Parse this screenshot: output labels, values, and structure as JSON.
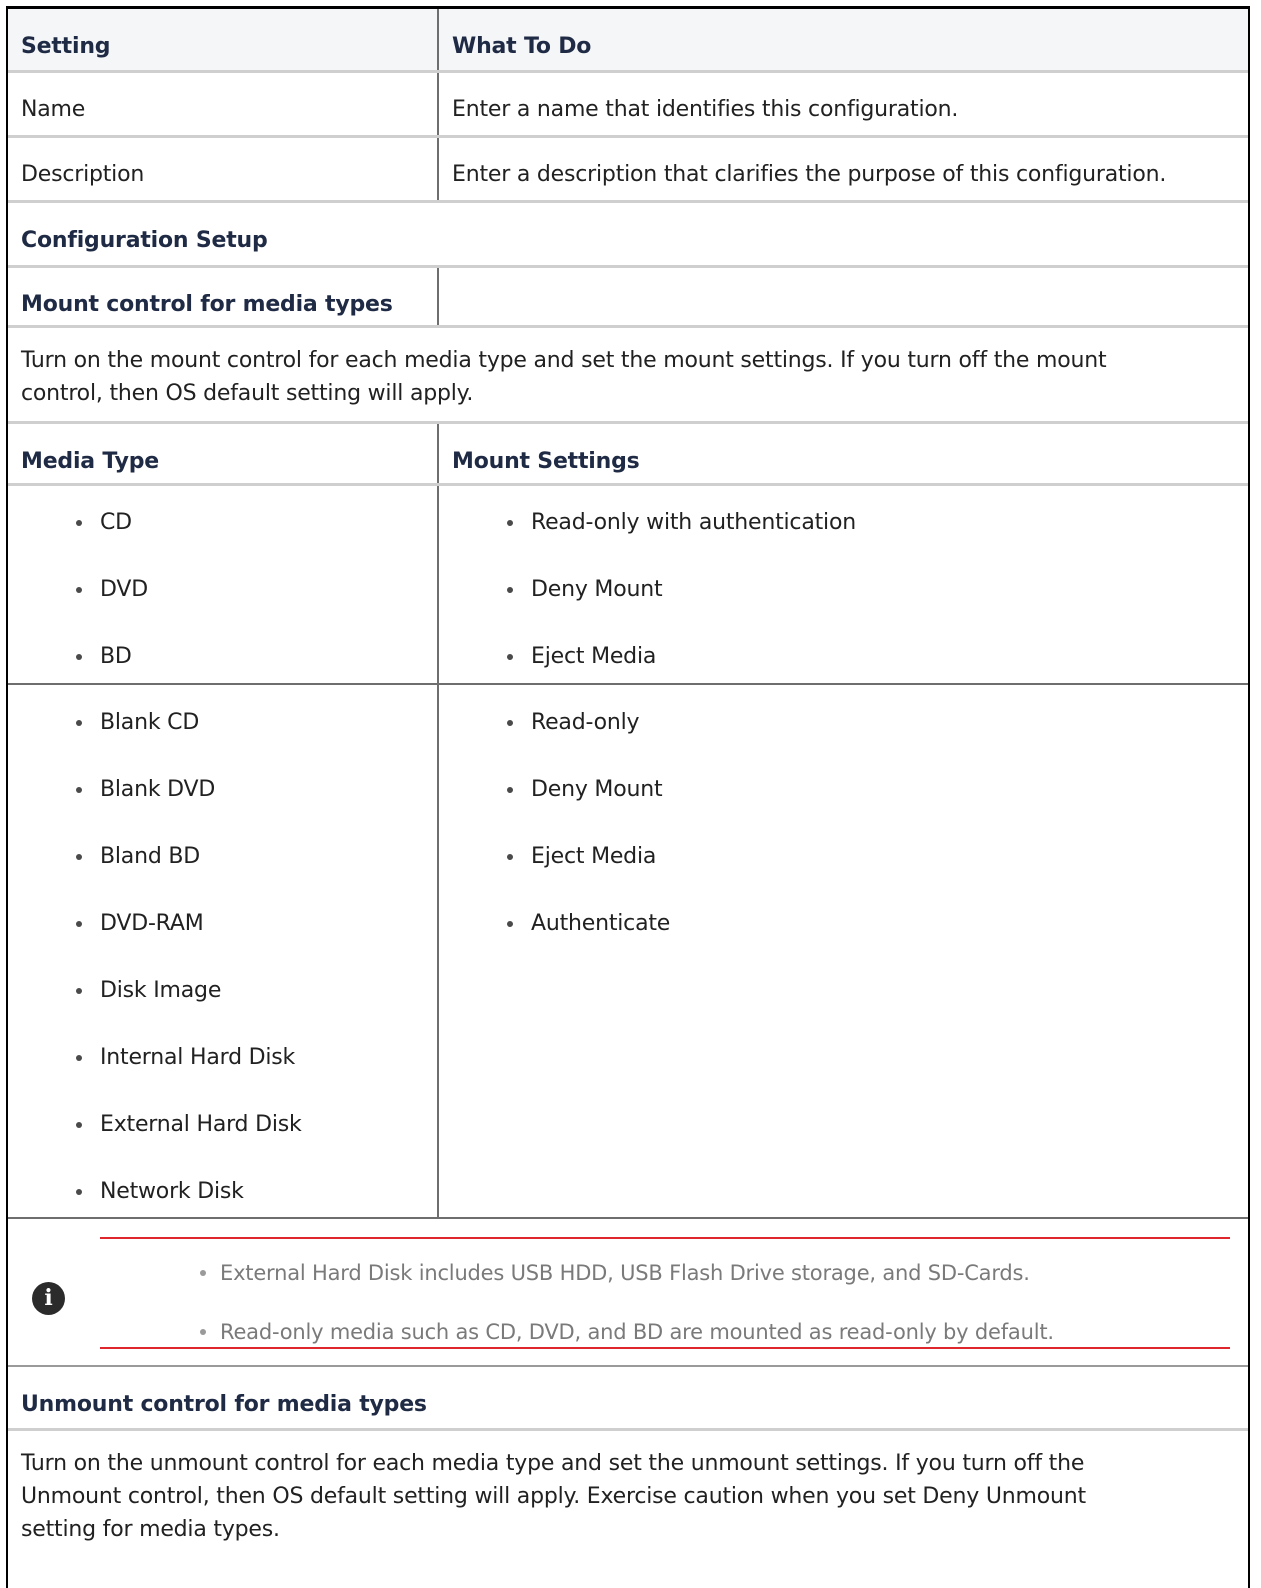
{
  "header": {
    "col1": "Setting",
    "col2": "What To Do"
  },
  "rows": [
    {
      "setting": "Name",
      "action": "Enter a name that identifies this configuration."
    },
    {
      "setting": "Description",
      "action": "Enter a description that clarifies the purpose of this configuration."
    }
  ],
  "config_setup": "Configuration Setup",
  "mount_section": {
    "title": "Mount control for media types",
    "intro_line1": "Turn on the mount control for each media type and set the mount settings. If you turn off the mount",
    "intro_line2": "control, then OS default setting will apply.",
    "col1": "Media Type",
    "col2": "Mount Settings",
    "group1": {
      "media": [
        "CD",
        "DVD",
        "BD"
      ],
      "settings": [
        "Read-only with authentication",
        "Deny Mount",
        "Eject Media"
      ]
    },
    "group2": {
      "media": [
        "Blank CD",
        "Blank DVD",
        "Bland BD",
        "DVD-RAM",
        "Disk Image",
        "Internal Hard Disk",
        "External Hard Disk",
        "Network Disk"
      ],
      "settings": [
        "Read-only",
        "Deny Mount",
        "Eject Media",
        "Authenticate"
      ]
    }
  },
  "note": {
    "icon": "info-icon",
    "items": [
      "External Hard Disk includes USB HDD, USB Flash Drive storage, and SD-Cards.",
      "Read-only media such as CD, DVD, and BD are mounted as read-only by default."
    ],
    "accent": "#e0262d"
  },
  "unmount_section": {
    "title": "Unmount control for media types",
    "intro_line1": "Turn on the unmount control for each media type and set the unmount settings. If you turn off the",
    "intro_line2": "Unmount control, then OS default setting will apply. Exercise caution when you set Deny Unmount",
    "intro_line3": "setting for media types."
  }
}
